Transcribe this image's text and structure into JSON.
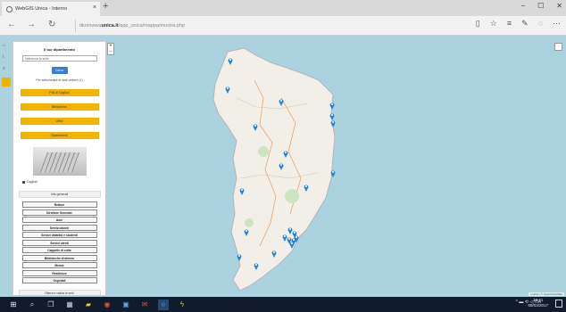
{
  "browser": {
    "tab_title": "WebGIS Unica - Interno",
    "tab_close": "×",
    "new_tab": "+",
    "url_prefix": "diorinwwa",
    "url_host": "unica.it",
    "url_path": "/app_unica/mappa/mostra.php",
    "window_controls": [
      "−",
      "☐",
      "✕"
    ],
    "nav": {
      "back": "←",
      "forward": "→",
      "refresh": "↻"
    },
    "toolbar_icons": [
      "reading-view-icon",
      "favorite-star-icon",
      "hub-icon",
      "notes-icon",
      "share-icon",
      "more-icon"
    ]
  },
  "panel": {
    "title": "Il tuo dipartimento",
    "select_value": "Seleziona la sede",
    "submit_label": "Cerca",
    "note": "Per selezionare le sedi vedere (1)",
    "yellow_buttons": [
      "Poli di Cagliari",
      "Biblioteche",
      "Uffici",
      "Dipartimenti"
    ],
    "photo_caption": "Cagliari",
    "section_title": "Info generali",
    "layers": [
      "Rettore",
      "Direttore Generale",
      "Aule",
      "Servizi alunni",
      "Servizi didattici e studenti",
      "Servizi utenti",
      "Cappelle di culto",
      "Biblioteche di ateneo",
      "Mense",
      "Residenze",
      "Ospedali"
    ],
    "footer_label": "Rileva e valuta le sedi"
  },
  "map": {
    "zoom_in": "+",
    "zoom_out": "−",
    "attribution": "Leaflet | © OpenStreetMap",
    "sea_color": "#aad3df",
    "land_color": "#f2efe9",
    "pin_color": "#2a81cb",
    "marker_count": 23
  },
  "taskbar": {
    "icons": [
      "start-icon",
      "search-icon",
      "task-view-icon",
      "calculator-icon",
      "explorer-icon",
      "chrome-icon",
      "store-icon",
      "mail-icon",
      "edge-icon",
      "lightning-icon"
    ],
    "tray": "^ ▬ ⟲ ◁ ITA",
    "time": "16:41",
    "date": "08/03/2017"
  }
}
